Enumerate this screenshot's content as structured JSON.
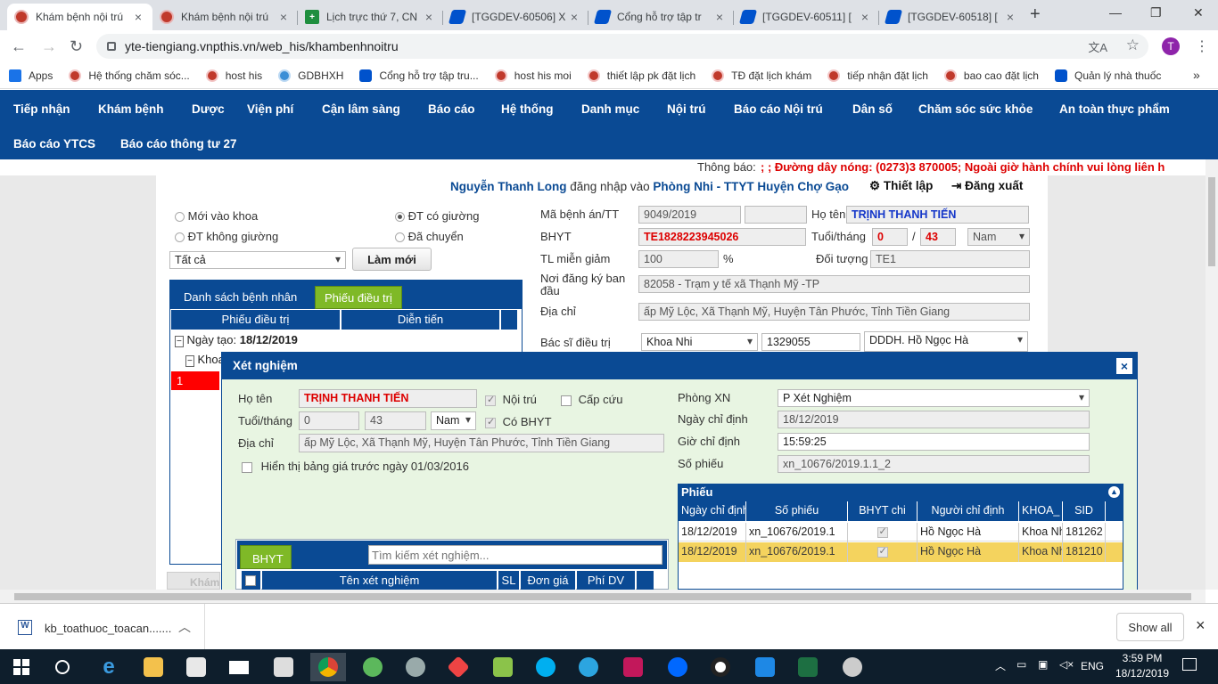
{
  "browser": {
    "tabs": [
      {
        "title": "Khám bệnh nội trú",
        "icon": "his-logo-icon",
        "active": true
      },
      {
        "title": "Khám bệnh nội trú",
        "icon": "his-logo-icon",
        "active": false
      },
      {
        "title": "Lịch trực thứ 7, CN",
        "icon": "sheets-icon",
        "active": false
      },
      {
        "title": "[TGGDEV-60506] X",
        "icon": "jira-icon",
        "active": false
      },
      {
        "title": "Cổng hỗ trợ tập tr",
        "icon": "jira-icon",
        "active": false
      },
      {
        "title": "[TGGDEV-60511] [",
        "icon": "jira-icon",
        "active": false
      },
      {
        "title": "[TGGDEV-60518] [",
        "icon": "jira-icon",
        "active": false
      }
    ],
    "new_tab": "+",
    "url": "yte-tiengiang.vnpthis.vn/web_his/khambenhnoitru",
    "profile_initial": "T",
    "bookmarks": [
      "Apps",
      "Hệ thống chăm sóc...",
      "host his",
      "GDBHXH",
      "Cổng hỗ trợ tập tru...",
      "host his moi",
      "thiết lập pk đặt lịch",
      "TĐ đặt lịch khám",
      "tiếp nhận đặt lịch",
      "bao cao đặt lịch",
      "Quản lý nhà thuốc"
    ],
    "bookmarks_more": "»"
  },
  "menu": {
    "row1": [
      "Tiếp nhận",
      "Khám bệnh",
      "Dược",
      "Viện phí",
      "Cận lâm sàng",
      "Báo cáo",
      "Hệ thống",
      "Danh mục",
      "Nội trú",
      "Báo cáo Nội trú",
      "Dân số",
      "Chăm sóc sức khỏe",
      "An toàn thực phẩm"
    ],
    "row2": [
      "Báo cáo YTCS",
      "Báo cáo thông tư 27"
    ]
  },
  "notice": {
    "label": "Thông báo:",
    "text": "; ; Đường dây nóng: (0273)3 870005; Ngoài giờ hành chính vui lòng liên h"
  },
  "userbar": {
    "user": "Nguyễn Thanh Long",
    "login_text": "đăng nhập vào",
    "room": "Phòng Nhi",
    "dash": "-",
    "facility": "TTYT Huyện Chợ Gạo",
    "settings": "Thiết lập",
    "logout": "Đăng xuất"
  },
  "filters": {
    "radio_new": "Mới vào khoa",
    "radio_bed": "ĐT có giường",
    "radio_nobed": "ĐT không giường",
    "radio_moved": "Đã chuyển",
    "select_all": "Tất cả",
    "refresh": "Làm mới"
  },
  "left_panel": {
    "tab_patients": "Danh sách bệnh nhân",
    "tab_treatment": "Phiếu điều trị",
    "col_sheet": "Phiếu điều trị",
    "col_progress": "Diễn tiến",
    "group_label": "Ngày tạo:",
    "group_date": "18/12/2019",
    "subgroup": "Khoa",
    "row_num": "1",
    "collapsed_btn": "Khám"
  },
  "patient": {
    "record_label": "Mã bệnh án/TT",
    "record_value": "9049/2019",
    "name_label": "Họ tên",
    "name_value": "TRỊNH THANH TIẾN",
    "bhyt_label": "BHYT",
    "bhyt_value": "TE1828223945026",
    "age_label": "Tuổi/tháng",
    "age_years": "0",
    "age_sep": "/",
    "age_months": "43",
    "gender": "Nam",
    "discount_label": "TL miễn giảm",
    "discount_value": "100",
    "discount_unit": "%",
    "subject_label": "Đối tượng",
    "subject_value": "TE1",
    "register_label": "Nơi đăng ký ban đầu",
    "register_value": "82058 - Trạm y tế xã Thạnh Mỹ -TP",
    "address_label": "Địa chỉ",
    "address_value": "ấp Mỹ Lộc, Xã Thạnh Mỹ, Huyện Tân Phước, Tỉnh Tiền Giang",
    "doctor_label": "Bác sĩ điều trị",
    "dept_value": "Khoa Nhi",
    "doctor_code": "1329055",
    "doctor_name": "DDDH. Hồ Ngọc Hà"
  },
  "modal": {
    "title": "Xét nghiệm",
    "close": "×",
    "name_label": "Họ tên",
    "name_value": "TRỊNH THANH TIẾN",
    "inpatient": "Nội trú",
    "emergency": "Cấp cứu",
    "age_label": "Tuổi/tháng",
    "age_years": "0",
    "age_months": "43",
    "gender": "Nam",
    "has_bhyt": "Có BHYT",
    "address_label": "Địa chỉ",
    "address_value": "ấp Mỹ Lộc, Xã Thạnh Mỹ, Huyện Tân Phước, Tỉnh Tiền Giang",
    "show_price": "Hiển thị bảng giá trước ngày 01/03/2016",
    "lab_room_label": "Phòng XN",
    "lab_room_value": "P Xét Nghiệm",
    "order_date_label": "Ngày chỉ định",
    "order_date_value": "18/12/2019",
    "order_time_label": "Giờ chỉ định",
    "order_time_value": "15:59:25",
    "ticket_label": "Số phiếu",
    "ticket_value": "xn_10676/2019.1.1_2",
    "bhyt_tab": "BHYT",
    "search_placeholder": "Tìm kiếm xét nghiệm...",
    "test_cols": [
      "Tên xét nghiệm",
      "SL",
      "Đơn giá",
      "Phí DV"
    ]
  },
  "ticket_grid": {
    "title": "Phiếu",
    "columns": [
      "Ngày chỉ định",
      "Số phiếu",
      "BHYT chi",
      "Người chỉ định",
      "KHOA_",
      "SID"
    ],
    "rows": [
      {
        "date": "18/12/2019",
        "ticket": "xn_10676/2019.1",
        "doctor": "Hồ Ngọc Hà",
        "dept": "Khoa Nhi",
        "sid": "181262",
        "selected": false
      },
      {
        "date": "18/12/2019",
        "ticket": "xn_10676/2019.1",
        "doctor": "Hồ Ngọc Hà",
        "dept": "Khoa Nhi",
        "sid": "181210",
        "selected": true
      }
    ]
  },
  "download": {
    "file": "kb_toathuoc_toacan.......",
    "show_all": "Show all",
    "close": "×"
  },
  "taskbar": {
    "lang": "ENG",
    "time": "3:59 PM",
    "date": "18/12/2019"
  },
  "colors": {
    "nav_blue": "#0a4a94",
    "accent_green": "#7fb927",
    "alert_red": "#dd0000",
    "selected_row": "#f4d35e"
  }
}
